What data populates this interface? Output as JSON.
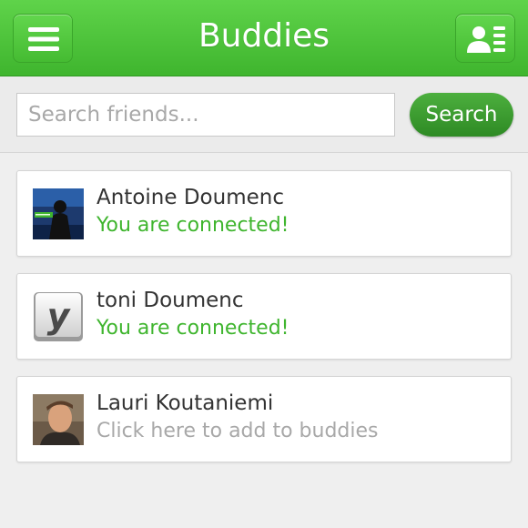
{
  "header": {
    "title": "Buddies",
    "menu_icon": "hamburger-menu-icon",
    "contacts_icon": "contact-list-icon"
  },
  "search": {
    "placeholder": "Search friends...",
    "value": "",
    "button_label": "Search"
  },
  "buddies": [
    {
      "name": "Antoine Doumenc",
      "status": "You are connected!",
      "connected": true,
      "avatar": "video-thumbnail-avatar"
    },
    {
      "name": "toni Doumenc",
      "status": "You are connected!",
      "connected": true,
      "avatar": "y-letter-key-avatar"
    },
    {
      "name": "Lauri Koutaniemi",
      "status": "Click here to add to buddies",
      "connected": false,
      "avatar": "photo-portrait-avatar"
    }
  ],
  "colors": {
    "header_green": "#4cc33a",
    "connected_text": "#3fb52e",
    "pending_text": "#a8a8a8",
    "search_button": "#3a9a2e"
  }
}
